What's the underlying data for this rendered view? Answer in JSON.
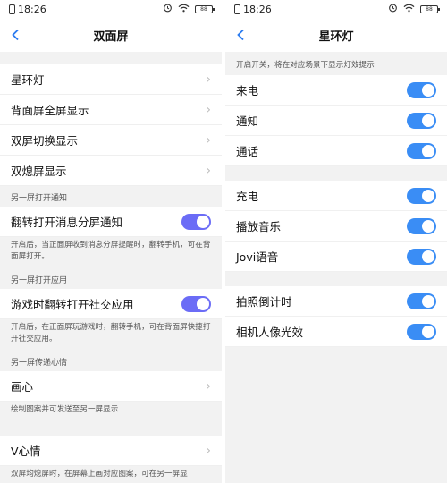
{
  "left": {
    "status": {
      "time": "18:26",
      "battery": "88"
    },
    "title": "双面屏",
    "items_top": [
      {
        "label": "星环灯"
      },
      {
        "label": "背面屏全屏显示"
      },
      {
        "label": "双屏切换显示"
      },
      {
        "label": "双熄屏显示"
      }
    ],
    "section1": {
      "header": "另一屏打开通知",
      "toggle_label": "翻转打开消息分屏通知",
      "desc": "开启后，当正面屏收到消息分屏提醒时，翻转手机，可在背面屏打开。"
    },
    "section2": {
      "header": "另一屏打开应用",
      "toggle_label": "游戏时翻转打开社交应用",
      "desc": "开启后，在正面屏玩游戏时，翻转手机，可在背面屏快捷打开社交应用。"
    },
    "section3": {
      "header": "另一屏传递心情",
      "item": "画心",
      "desc": "绘制图案并可发送至另一屏显示"
    },
    "vheart": {
      "item": "V心情",
      "desc": "双屏均熄屏时，在屏幕上画对应图案，可在另一屏显"
    }
  },
  "right": {
    "status": {
      "time": "18:26",
      "battery": "88"
    },
    "title": "星环灯",
    "hint": "开启开关，将在对应场景下显示灯效提示",
    "group1": [
      {
        "label": "来电",
        "on": true
      },
      {
        "label": "通知",
        "on": true
      },
      {
        "label": "通话",
        "on": true
      }
    ],
    "group2": [
      {
        "label": "充电",
        "on": true
      },
      {
        "label": "播放音乐",
        "on": true
      },
      {
        "label": "Jovi语音",
        "on": true
      }
    ],
    "group3": [
      {
        "label": "拍照倒计时",
        "on": true
      },
      {
        "label": "相机人像光效",
        "on": true
      }
    ]
  },
  "colors": {
    "accent": "#3a8df5",
    "toggle_alt": "#6b6cf6",
    "back": "#2b7bf0"
  }
}
